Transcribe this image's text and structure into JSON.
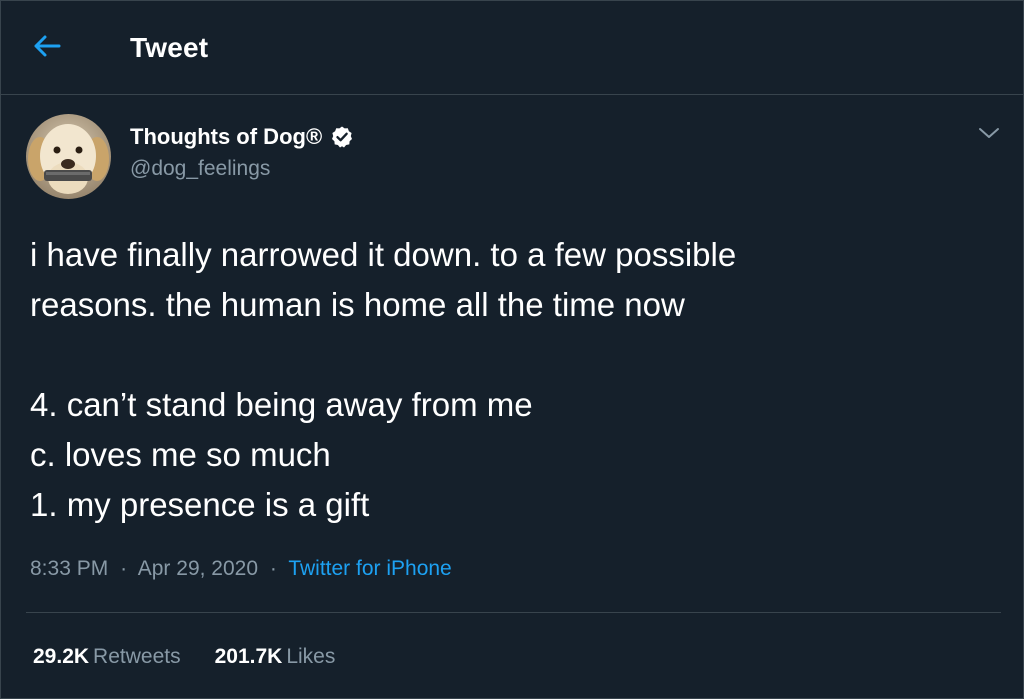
{
  "header": {
    "title": "Tweet",
    "back_icon": "arrow-left-icon"
  },
  "author": {
    "display_name": "Thoughts of Dog®",
    "handle": "@dog_feelings",
    "verified_icon": "verified-badge-icon",
    "avatar": "dog-avatar"
  },
  "tweet": {
    "lines": [
      "i have finally narrowed it down. to a few possible",
      "reasons. the human is home all the time now",
      "",
      "4. can’t stand being away from me",
      "c. loves me so much",
      "1. my presence is a gift"
    ],
    "time": "8:33 PM",
    "date": "Apr 29, 2020",
    "separator": "·",
    "source": "Twitter for iPhone"
  },
  "stats": {
    "retweets_count": "29.2K",
    "retweets_label": "Retweets",
    "likes_count": "201.7K",
    "likes_label": "Likes"
  },
  "colors": {
    "background": "#15202b",
    "border": "#38444d",
    "accent": "#1da1f2",
    "secondary_text": "#8899a6",
    "primary_text": "#ffffff"
  }
}
